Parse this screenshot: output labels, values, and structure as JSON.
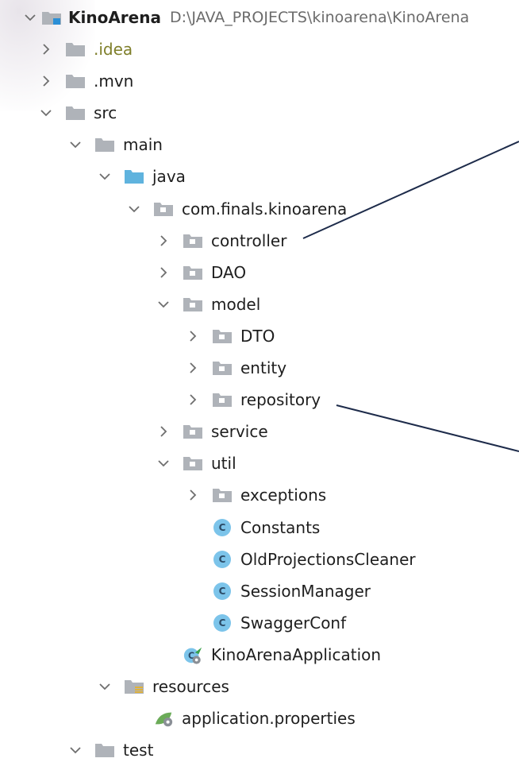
{
  "project": {
    "name": "KinoArena",
    "path": "D:\\JAVA_PROJECTS\\kinoarena\\KinoArena"
  },
  "items": [
    {
      "label": ".idea",
      "kind": "folder",
      "level": 1,
      "state": "collapsed",
      "icon": "folder-icon"
    },
    {
      "label": ".mvn",
      "kind": "folder",
      "level": 1,
      "state": "collapsed",
      "icon": "folder-icon"
    },
    {
      "label": "src",
      "kind": "folder",
      "level": 1,
      "state": "expanded",
      "icon": "folder-icon"
    },
    {
      "label": "main",
      "kind": "folder",
      "level": 2,
      "state": "expanded",
      "icon": "folder-icon"
    },
    {
      "label": "java",
      "kind": "source-folder",
      "level": 3,
      "state": "expanded",
      "icon": "source-folder-icon"
    },
    {
      "label": "com.finals.kinoarena",
      "kind": "package",
      "level": 4,
      "state": "expanded",
      "icon": "package-icon"
    },
    {
      "label": "controller",
      "kind": "package",
      "level": 5,
      "state": "collapsed",
      "icon": "package-icon"
    },
    {
      "label": "DAO",
      "kind": "package",
      "level": 5,
      "state": "collapsed",
      "icon": "package-icon"
    },
    {
      "label": "model",
      "kind": "package",
      "level": 5,
      "state": "expanded",
      "icon": "package-icon"
    },
    {
      "label": "DTO",
      "kind": "package",
      "level": 6,
      "state": "collapsed",
      "icon": "package-icon"
    },
    {
      "label": "entity",
      "kind": "package",
      "level": 6,
      "state": "collapsed",
      "icon": "package-icon"
    },
    {
      "label": "repository",
      "kind": "package",
      "level": 6,
      "state": "collapsed",
      "icon": "package-icon"
    },
    {
      "label": "service",
      "kind": "package",
      "level": 5,
      "state": "collapsed",
      "icon": "package-icon"
    },
    {
      "label": "util",
      "kind": "package",
      "level": 5,
      "state": "expanded",
      "icon": "package-icon"
    },
    {
      "label": "exceptions",
      "kind": "package",
      "level": 6,
      "state": "collapsed",
      "icon": "package-icon"
    },
    {
      "label": "Constants",
      "kind": "class",
      "level": 6,
      "state": "leaf",
      "icon": "class-icon"
    },
    {
      "label": "OldProjectionsCleaner",
      "kind": "class",
      "level": 6,
      "state": "leaf",
      "icon": "class-icon"
    },
    {
      "label": "SessionManager",
      "kind": "class",
      "level": 6,
      "state": "leaf",
      "icon": "class-icon"
    },
    {
      "label": "SwaggerConf",
      "kind": "class",
      "level": 6,
      "state": "leaf",
      "icon": "class-icon"
    },
    {
      "label": "KinoArenaApplication",
      "kind": "spring-app",
      "level": 5,
      "state": "leaf",
      "icon": "spring-boot-class-icon"
    },
    {
      "label": "resources",
      "kind": "resources",
      "level": 3,
      "state": "expanded",
      "icon": "resources-folder-icon"
    },
    {
      "label": "application.properties",
      "kind": "properties",
      "level": 4,
      "state": "leaf",
      "icon": "properties-file-icon"
    },
    {
      "label": "test",
      "kind": "folder",
      "level": 2,
      "state": "expanded",
      "icon": "folder-icon"
    }
  ],
  "class_letter": "C",
  "colors": {
    "folder": "#afb3b9",
    "source_folder": "#5fb3de",
    "class_circle": "#7cc4ea",
    "idea_text": "#7f7f2a",
    "callout_line": "#1d2b4a"
  }
}
